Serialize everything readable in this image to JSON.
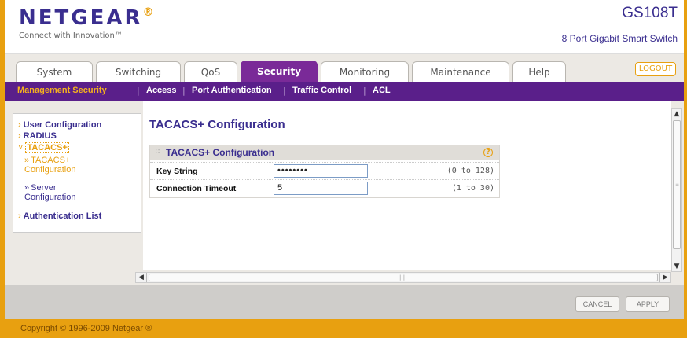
{
  "header": {
    "logo": "NETGEAR",
    "logo_mark": "®",
    "tagline": "Connect with Innovation™",
    "model": "GS108T",
    "description": "8 Port Gigabit Smart Switch"
  },
  "tabs": [
    {
      "label": "System"
    },
    {
      "label": "Switching"
    },
    {
      "label": "QoS"
    },
    {
      "label": "Security"
    },
    {
      "label": "Monitoring"
    },
    {
      "label": "Maintenance"
    },
    {
      "label": "Help"
    }
  ],
  "logout_label": "LOGOUT",
  "subnav": [
    {
      "label": "Management Security"
    },
    {
      "label": "Access"
    },
    {
      "label": "Port Authentication"
    },
    {
      "label": "Traffic Control"
    },
    {
      "label": "ACL"
    }
  ],
  "subnav_separator": "|",
  "sidebar": {
    "items": [
      {
        "label": "User Configuration",
        "arrow": "›"
      },
      {
        "label": "RADIUS",
        "arrow": "›"
      },
      {
        "label": "TACACS+",
        "arrow": "˅"
      },
      {
        "label": "Authentication List",
        "arrow": "›"
      }
    ],
    "subitems": [
      {
        "line1": "TACACS+",
        "line2": "Configuration",
        "arrow": "»"
      },
      {
        "line1": "Server",
        "line2": "Configuration",
        "arrow": "»"
      }
    ]
  },
  "main": {
    "title": "TACACS+ Configuration",
    "panel": {
      "title": "TACACS+ Configuration",
      "grip": "::",
      "help_icon": "?",
      "rows": [
        {
          "label": "Key String",
          "value": "••••••••",
          "range": "(0 to 128)"
        },
        {
          "label": "Connection Timeout",
          "value": "5",
          "range": "(1 to 30)"
        }
      ]
    }
  },
  "scroll": {
    "up": "▲",
    "down": "▼",
    "left": "◀",
    "right": "▶",
    "vgrip": "≡",
    "hgrip": "|||"
  },
  "buttons": {
    "cancel": "CANCEL",
    "apply": "APPLY"
  },
  "footer": {
    "copyright": "Copyright © 1996-2009 Netgear ®"
  },
  "colors": {
    "brand_purple": "#5a1f8a",
    "accent_orange": "#e8a010",
    "title_blue": "#3a2e8f"
  }
}
